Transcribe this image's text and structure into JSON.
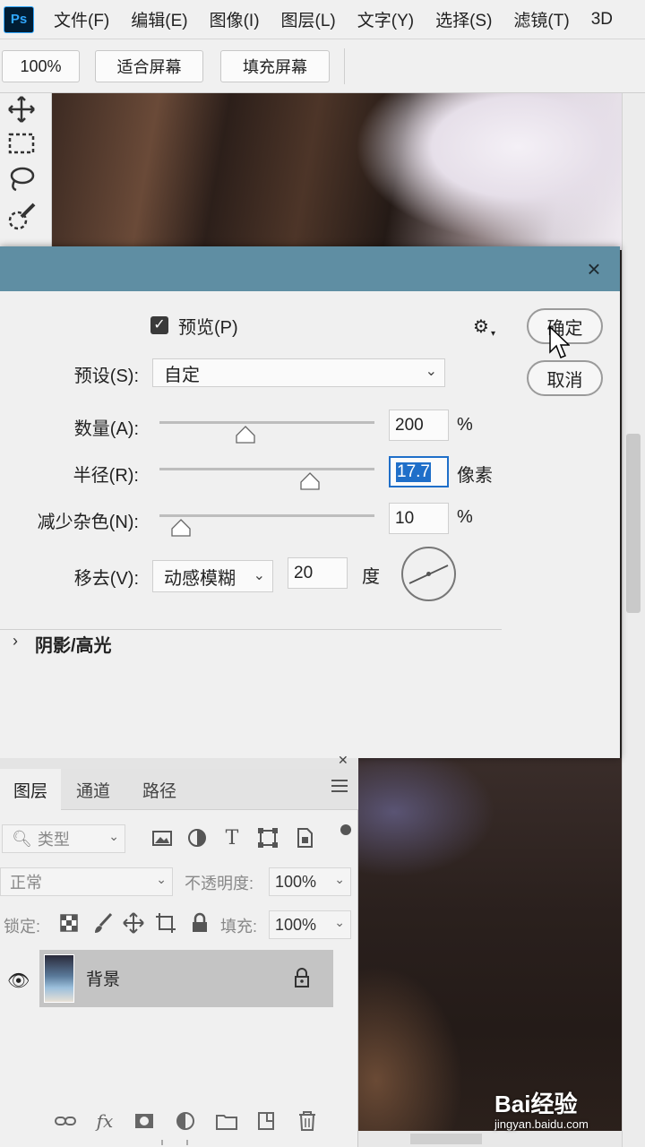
{
  "app": {
    "logo": "Ps"
  },
  "menu": [
    "文件(F)",
    "编辑(E)",
    "图像(I)",
    "图层(L)",
    "文字(Y)",
    "选择(S)",
    "滤镜(T)",
    "3D"
  ],
  "options": {
    "zoom": "100%",
    "fit_screen": "适合屏幕",
    "fill_screen": "填充屏幕"
  },
  "dialog": {
    "close_icon": "×",
    "preview_label": "预览(P)",
    "preview_checked": true,
    "ok_label": "确定",
    "cancel_label": "取消",
    "preset_label": "预设(S):",
    "preset_value": "自定",
    "amount_label": "数量(A):",
    "amount_value": "200",
    "amount_unit": "%",
    "amount_slider": 0.4,
    "radius_label": "半径(R):",
    "radius_value": "17.7",
    "radius_unit": "像素",
    "radius_slider": 0.7,
    "noise_label": "减少杂色(N):",
    "noise_value": "10",
    "noise_unit": "%",
    "noise_slider": 0.1,
    "remove_label": "移去(V):",
    "remove_value": "动感模糊",
    "angle_value": "20",
    "angle_unit": "度",
    "section_shadows": "阴影/高光"
  },
  "layers_panel": {
    "tabs": [
      "图层",
      "通道",
      "路径"
    ],
    "filter_placeholder": "类型",
    "blend_mode": "正常",
    "opacity_label": "不透明度:",
    "opacity_value": "100%",
    "lock_label": "锁定:",
    "fill_label": "填充:",
    "fill_value": "100%",
    "layer_name": "背景",
    "bottom_fx": "fx"
  },
  "watermark": {
    "brand": "Bai经验",
    "url": "jingyan.baidu.com"
  }
}
